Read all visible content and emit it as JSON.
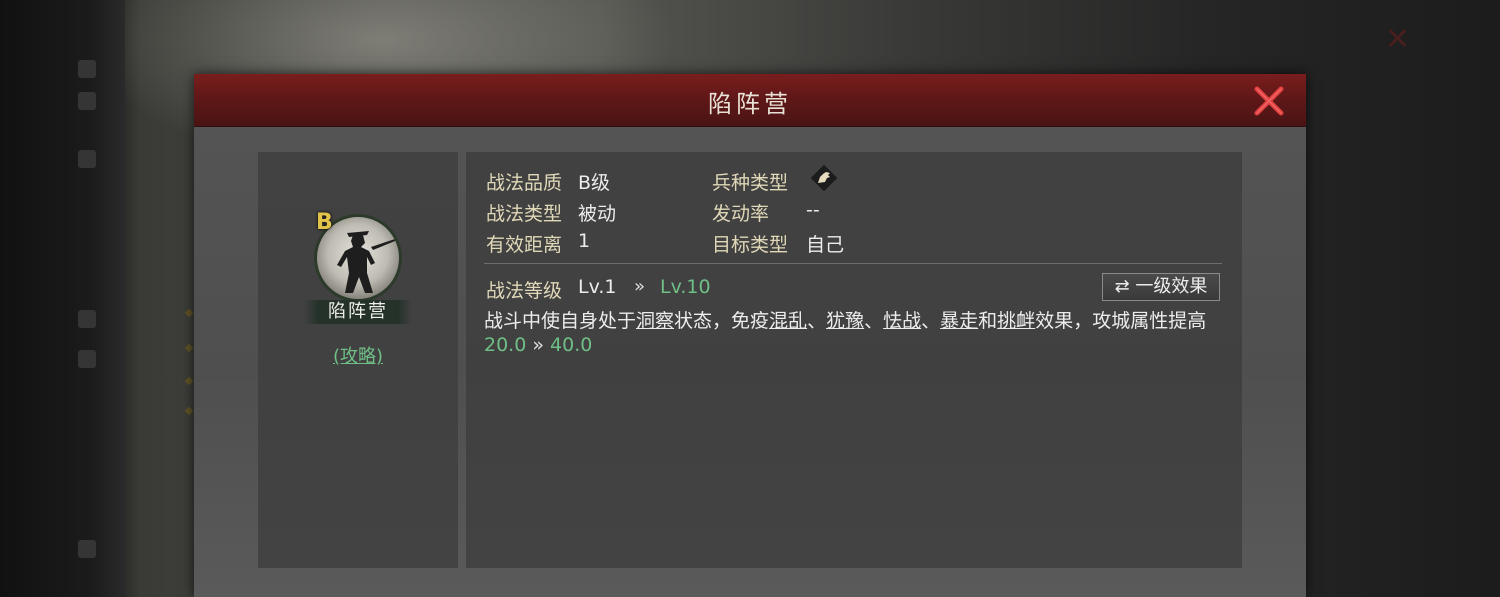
{
  "modal": {
    "title": "陷阵营",
    "close_icon": "close-x-icon"
  },
  "skill_card": {
    "grade": "B",
    "name": "陷阵营",
    "guide_link": "(攻略)"
  },
  "info": {
    "quality_label": "战法品质",
    "quality_value": "B级",
    "skill_type_label": "战法类型",
    "skill_type_value": "被动",
    "range_label": "有效距离",
    "range_value": "1",
    "troop_type_label": "兵种类型",
    "troop_type_icon": "cavalry-horse-icon",
    "trigger_rate_label": "发动率",
    "trigger_rate_value": "--",
    "target_type_label": "目标类型",
    "target_type_value": "自己"
  },
  "level": {
    "label": "战法等级",
    "current": "Lv.1",
    "arrow": "»",
    "max": "Lv.10",
    "toggle_icon": "swap-arrows-icon",
    "toggle_label": "一级效果"
  },
  "description": {
    "parts": [
      {
        "text": "战斗中使自身处于",
        "link": false
      },
      {
        "text": "洞察",
        "link": true
      },
      {
        "text": "状态，免疫",
        "link": false
      },
      {
        "text": "混乱",
        "link": true
      },
      {
        "text": "、",
        "link": false
      },
      {
        "text": "犹豫",
        "link": true
      },
      {
        "text": "、",
        "link": false
      },
      {
        "text": "怯战",
        "link": true
      },
      {
        "text": "、",
        "link": false
      },
      {
        "text": "暴走",
        "link": true
      },
      {
        "text": "和",
        "link": false
      },
      {
        "text": "挑衅",
        "link": true
      },
      {
        "text": "效果，攻城属性提高",
        "link": false
      }
    ],
    "value_from": "20.0",
    "value_arrow": "»",
    "value_to": "40.0"
  },
  "colors": {
    "header_red": "#6a1a1a",
    "accent_green": "#6fbf86",
    "label_gold": "#e0d8b8",
    "grade_gold": "#e3c44a",
    "close_red": "#e04040"
  }
}
